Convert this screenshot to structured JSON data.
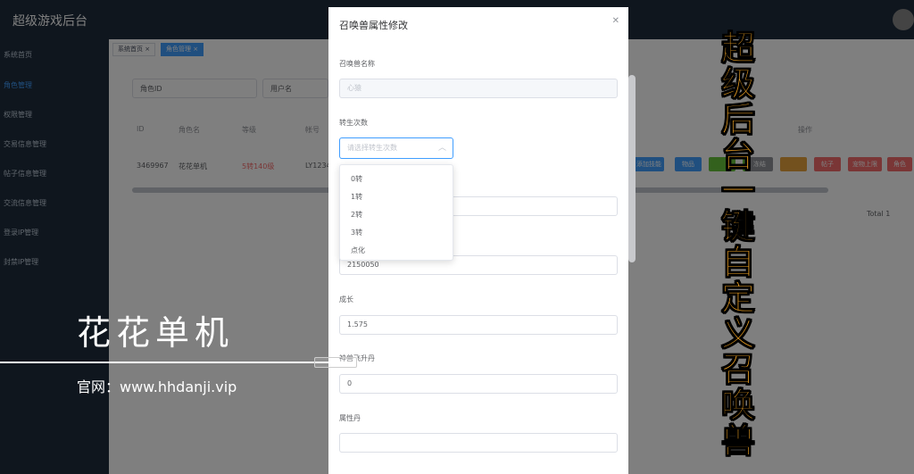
{
  "app": {
    "title": "超级游戏后台"
  },
  "sidebar": {
    "items": [
      {
        "label": "系统首页"
      },
      {
        "label": "角色管理"
      },
      {
        "label": "权限管理"
      },
      {
        "label": "交易信息管理"
      },
      {
        "label": "帖子信息管理"
      },
      {
        "label": "交流信息管理"
      },
      {
        "label": "登录IP管理"
      },
      {
        "label": "封禁IP管理"
      }
    ]
  },
  "tabs": [
    {
      "label": "系统首页 ×"
    },
    {
      "label": "角色管理 ×"
    }
  ],
  "filters": {
    "role_id_placeholder": "角色ID",
    "user_placeholder": "用户名"
  },
  "table": {
    "headers": [
      "ID",
      "角色名",
      "等级",
      "帐号",
      "操作"
    ],
    "row": {
      "id": "3469967",
      "name": "花花单机",
      "level": "5转140级",
      "account": "LY1234"
    },
    "ops": [
      "添加技能",
      "物品",
      "",
      "",
      "冻结",
      "",
      "帖子",
      "宠物上限",
      "角色"
    ],
    "total": "Total 1"
  },
  "colors": {
    "op_blue": "#409eff",
    "op_green": "#67c23a",
    "op_gray": "#909399",
    "op_orange": "#e6a23c",
    "op_red": "#f56c6c",
    "level_red": "#f56c6c"
  },
  "modal": {
    "title": "召唤兽属性修改",
    "close_icon": "close-icon",
    "name_label": "召唤兽名称",
    "name_value": "心猿",
    "rebirth_label": "转生次数",
    "rebirth_placeholder": "请选择转生次数",
    "rebirth_options": [
      "0转",
      "1转",
      "2转",
      "3转",
      "点化"
    ],
    "field2_value": "",
    "exp_value": "2150050",
    "growth_label": "成长",
    "growth_value": "1.575",
    "shenshou_label": "神兽飞升丹",
    "shenshou_value": "0",
    "attr_label": "属性丹",
    "attr_value": ""
  },
  "watermark": {
    "title": "花花单机",
    "url": "官网：www.hhdanji.vip",
    "vertical": "超级后台一键自定义召唤兽"
  }
}
